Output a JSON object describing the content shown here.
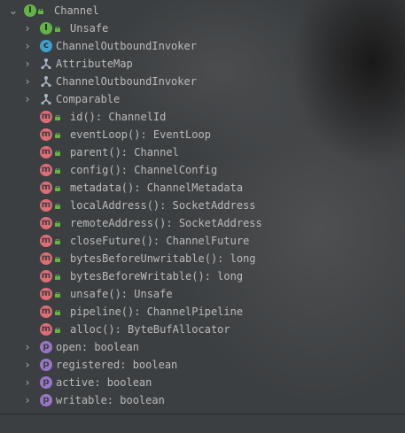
{
  "tree": {
    "root": {
      "label": "Channel",
      "kind": "interface",
      "badge": "I"
    },
    "supertypes": [
      {
        "label": "Unsafe",
        "kind": "interface",
        "badge": "I"
      },
      {
        "label": "ChannelOutboundInvoker",
        "kind": "class",
        "badge": "c"
      },
      {
        "label": "AttributeMap",
        "kind": "inherited"
      },
      {
        "label": "ChannelOutboundInvoker",
        "kind": "inherited"
      },
      {
        "label": "Comparable",
        "kind": "inherited"
      }
    ],
    "methods": [
      {
        "label": "id(): ChannelId",
        "badge": "m"
      },
      {
        "label": "eventLoop(): EventLoop",
        "badge": "m"
      },
      {
        "label": "parent(): Channel",
        "badge": "m"
      },
      {
        "label": "config(): ChannelConfig",
        "badge": "m"
      },
      {
        "label": "metadata(): ChannelMetadata",
        "badge": "m"
      },
      {
        "label": "localAddress(): SocketAddress",
        "badge": "m"
      },
      {
        "label": "remoteAddress(): SocketAddress",
        "badge": "m"
      },
      {
        "label": "closeFuture(): ChannelFuture",
        "badge": "m"
      },
      {
        "label": "bytesBeforeUnwritable(): long",
        "badge": "m"
      },
      {
        "label": "bytesBeforeWritable(): long",
        "badge": "m"
      },
      {
        "label": "unsafe(): Unsafe",
        "badge": "m"
      },
      {
        "label": "pipeline(): ChannelPipeline",
        "badge": "m"
      },
      {
        "label": "alloc(): ByteBufAllocator",
        "badge": "m"
      }
    ],
    "properties": [
      {
        "label": "open: boolean",
        "badge": "p"
      },
      {
        "label": "registered: boolean",
        "badge": "p"
      },
      {
        "label": "active: boolean",
        "badge": "p"
      },
      {
        "label": "writable: boolean",
        "badge": "p"
      }
    ]
  },
  "colors": {
    "background": "#3c3f41",
    "text": "#bbbbbb",
    "interface_badge": "#62b543",
    "class_badge": "#409fcc",
    "method_badge": "#e06c75",
    "property_badge": "#9876c7",
    "lock": "#62b543"
  },
  "icons": {
    "expand_arrow": "›",
    "expanded_arrow": "⌄"
  }
}
